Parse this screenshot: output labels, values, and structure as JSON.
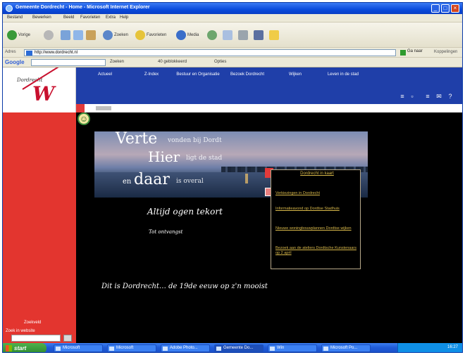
{
  "window": {
    "title": "Gemeente Dordrecht - Home - Microsoft Internet Explorer",
    "min": "_",
    "max": "□",
    "close": "×"
  },
  "menubar": [
    "Bestand",
    "Bewerken",
    "Beeld",
    "Favorieten",
    "Extra",
    "Help"
  ],
  "toolbar": {
    "back": "Vorige",
    "search": "Zoeken",
    "favorites": "Favorieten",
    "media": "Media"
  },
  "address": {
    "label": "Adres",
    "url": "http://www.dordrecht.nl",
    "go": "Ga naar",
    "links": "Koppelingen"
  },
  "googlebar": {
    "logo": "Google",
    "search": "Zoeken",
    "blocked": "40 geblokkeerd",
    "options": "Opties"
  },
  "site": {
    "logo_text": "Dordrecht",
    "logo_mark": "W",
    "nav": [
      {
        "label": "Actueel"
      },
      {
        "label": "Z-Index"
      },
      {
        "label": "Bestuur en Organisatie"
      },
      {
        "label": "Bezoek Dordrecht"
      },
      {
        "label": "Wijken"
      },
      {
        "label": "Leven in de stad"
      }
    ],
    "banner": {
      "line1_big": "Verte",
      "line1_small": "vonden bij Dordt",
      "line2_big": "Hier",
      "line2_small": "ligt de stad",
      "line3_pre": "en",
      "line3_big": "daar",
      "line3_small": "is overal"
    },
    "submenu": {
      "header": "Dordrecht in kaart",
      "items": [
        "Verkiezingen in Dordrecht",
        "Informatieavond op Dordtse Stadhuis",
        "Nieuwe woningbouwplannen Dordtse wijken",
        "Bezoek aan de ateliers Dordtsche Kunstenaars op 2 april"
      ]
    },
    "slogan": "Altijd ogen tekort",
    "by_label": "Tot ontvangst",
    "tagline": "Dit is Dordrecht… de 19de eeuw op z'n mooist",
    "sidebar_label1": "Zoekveld",
    "sidebar_label2": "Zoek in website"
  },
  "taskbar": {
    "start": "start",
    "tasks": [
      "Microsoft",
      "Microsoft",
      "Adobe Photo...",
      "Gemeente Do...",
      "Win",
      "Microsoft Po..."
    ],
    "clock": "16:27"
  }
}
